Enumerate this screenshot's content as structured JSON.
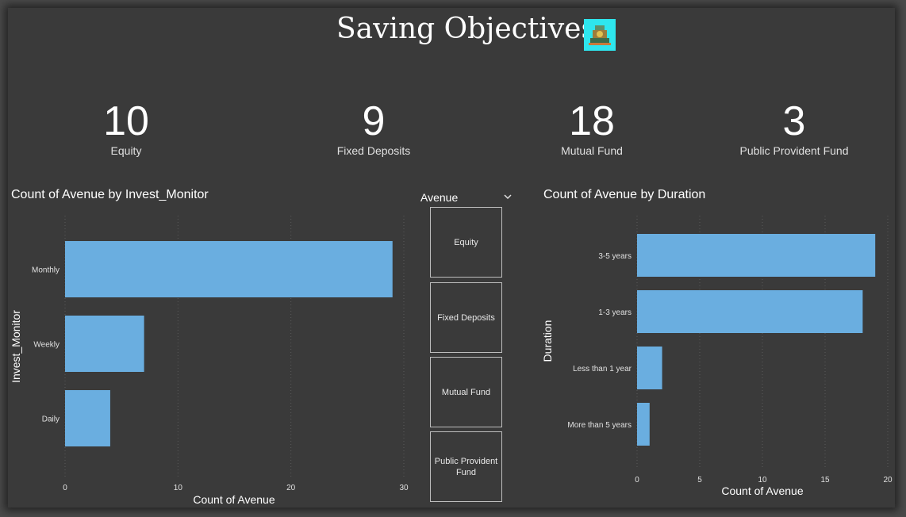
{
  "header": {
    "title": "Saving Objectives",
    "logo_icon": "investment-logo-icon"
  },
  "kpis": [
    {
      "value": "10",
      "label": "Equity"
    },
    {
      "value": "9",
      "label": "Fixed Deposits"
    },
    {
      "value": "18",
      "label": "Mutual Fund"
    },
    {
      "value": "3",
      "label": "Public Provident Fund"
    }
  ],
  "slicer": {
    "title": "Avenue",
    "dropdown_icon": "chevron-down-icon",
    "options": [
      "Equity",
      "Fixed Deposits",
      "Mutual Fund",
      "Public Provident Fund"
    ]
  },
  "colors": {
    "bar": "#6aaee0",
    "background": "#3a3a3a",
    "grid": "#5a5a5a"
  },
  "chart_data": [
    {
      "type": "bar",
      "orientation": "horizontal",
      "title": "Count of Avenue by Invest_Monitor",
      "categories": [
        "Monthly",
        "Weekly",
        "Daily"
      ],
      "values": [
        29,
        7,
        4
      ],
      "xlabel": "Count of Avenue",
      "ylabel": "Invest_Monitor",
      "xlim": [
        0,
        30
      ],
      "xticks": [
        "0",
        "10",
        "20",
        "30"
      ],
      "grid": true
    },
    {
      "type": "bar",
      "orientation": "horizontal",
      "title": "Count of Avenue by Duration",
      "categories": [
        "3-5 years",
        "1-3 years",
        "Less than 1 year",
        "More than 5 years"
      ],
      "values": [
        19,
        18,
        2,
        1
      ],
      "xlabel": "Count of Avenue",
      "ylabel": "Duration",
      "xlim": [
        0,
        20
      ],
      "xticks": [
        "0",
        "5",
        "10",
        "15",
        "20"
      ],
      "grid": true
    }
  ]
}
